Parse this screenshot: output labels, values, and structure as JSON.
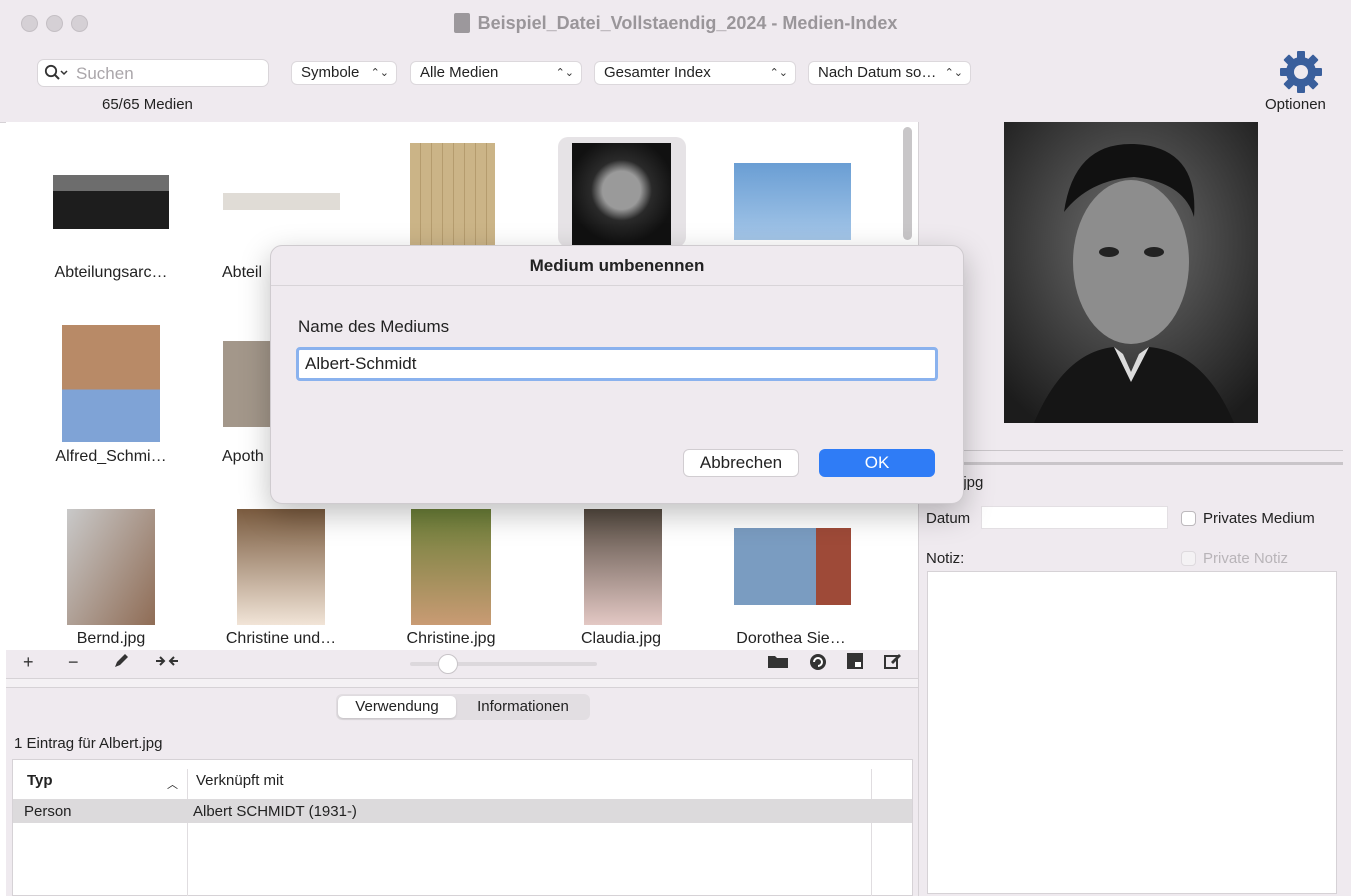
{
  "window": {
    "title": "Beispiel_Datei_Vollstaendig_2024 - Medien-Index"
  },
  "toolbar": {
    "search_placeholder": "Suchen",
    "media_count": "65/65 Medien",
    "popups": {
      "view": "Symbole",
      "filter": "Alle Medien",
      "scope": "Gesamter Index",
      "sort": "Nach Datum so…"
    },
    "options_label": "Optionen"
  },
  "grid": {
    "items": [
      {
        "label": "Abteilungsarc…"
      },
      {
        "label": "Abteil"
      },
      {
        "label": ""
      },
      {
        "label": ""
      },
      {
        "label": ""
      },
      {
        "label": "Alfred_Schmi…"
      },
      {
        "label": "Apoth"
      },
      {
        "label": "Bernd.jpg"
      },
      {
        "label": "Christine und…"
      },
      {
        "label": "Christine.jpg"
      },
      {
        "label": "Claudia.jpg"
      },
      {
        "label": "Dorothea Sie…"
      }
    ]
  },
  "grid_tools": {
    "add": "+",
    "remove": "−"
  },
  "bottom": {
    "tabs": [
      {
        "label": "Verwendung"
      },
      {
        "label": "Informationen"
      }
    ],
    "entry_count": "1 Eintrag für Albert.jpg",
    "columns": [
      {
        "label": "Typ"
      },
      {
        "label": "Verknüpft mit"
      }
    ],
    "rows": [
      {
        "type": "Person",
        "linked": "Albert SCHMIDT (1931-)"
      }
    ]
  },
  "right": {
    "filename": "rt.jpg",
    "date_label": "Datum",
    "private_media_label": "Privates Medium",
    "note_label": "Notiz:",
    "private_note_label": "Private Notiz"
  },
  "dialog": {
    "title": "Medium umbenennen",
    "field_label": "Name des Mediums",
    "field_value": "Albert-Schmidt",
    "cancel_label": "Abbrechen",
    "ok_label": "OK"
  },
  "colors": {
    "accent": "#2f7cf6",
    "chrome": "#efeaef"
  }
}
